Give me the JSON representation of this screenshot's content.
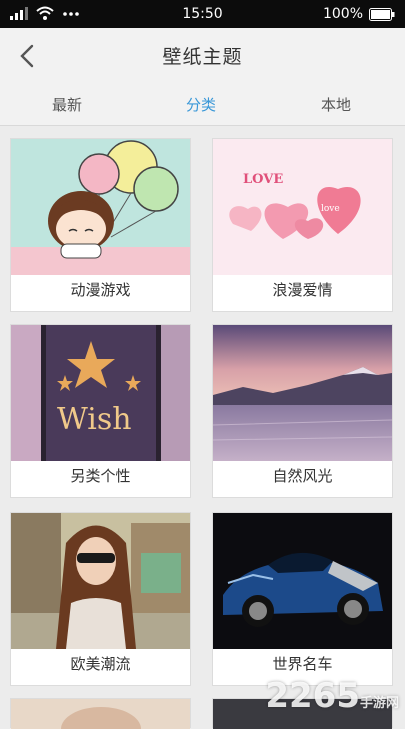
{
  "status_bar": {
    "time": "15:50",
    "battery": "100%",
    "icons": [
      "signal-icon",
      "wifi-icon",
      "more-dots-icon",
      "battery-icon"
    ]
  },
  "header": {
    "title": "壁纸主题",
    "back_icon": "chevron-left-icon"
  },
  "tabs": [
    {
      "label": "最新",
      "active": false
    },
    {
      "label": "分类",
      "active": true
    },
    {
      "label": "本地",
      "active": false
    }
  ],
  "categories": [
    {
      "label": "动漫游戏",
      "image": "cartoon-girl-balloons"
    },
    {
      "label": "浪漫爱情",
      "image": "love-hearts-candy"
    },
    {
      "label": "另类个性",
      "image": "wish-bottle-star"
    },
    {
      "label": "自然风光",
      "image": "lake-mountains-sunset"
    },
    {
      "label": "欧美潮流",
      "image": "girl-sunglasses-street"
    },
    {
      "label": "世界名车",
      "image": "blue-sports-car"
    }
  ],
  "colors": {
    "accent": "#3a98d8",
    "background": "#ececec",
    "header": "#f2f2f2"
  },
  "watermark": {
    "main": "2265",
    "sub": "手游网"
  }
}
